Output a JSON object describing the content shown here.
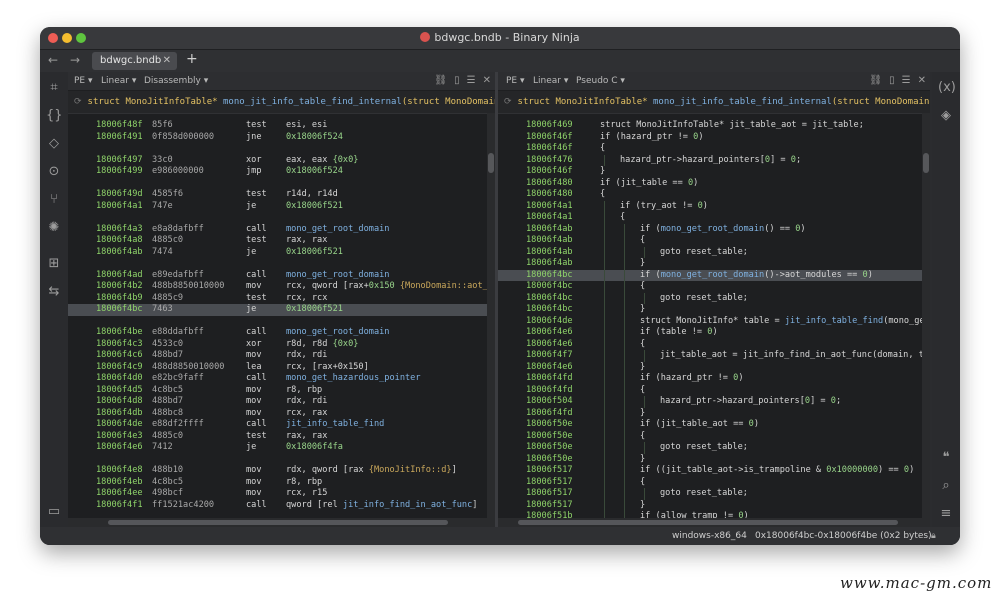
{
  "window": {
    "title": "bdwgc.bndb - Binary Ninja"
  },
  "tabs": [
    {
      "label": "bdwgc.bndb"
    }
  ],
  "left_pane": {
    "menu": [
      "PE ▾",
      "Linear ▾",
      "Disassembly ▾"
    ],
    "signature": {
      "ret_type": "struct MonoJitInfoTable*",
      "func": "mono_jit_info_table_find_internal",
      "params": "(struct MonoDomain*"
    },
    "rows": [
      {
        "addr": "18006f48f",
        "bytes": "85f6",
        "mn": "test",
        "ops": [
          {
            "t": "esi, esi"
          }
        ]
      },
      {
        "addr": "18006f491",
        "bytes": "0f858d000000",
        "mn": "jne",
        "ops": [
          {
            "t": "0x18006f524",
            "c": "num"
          }
        ]
      },
      {
        "blank": true
      },
      {
        "addr": "18006f497",
        "bytes": "33c0",
        "mn": "xor",
        "ops": [
          {
            "t": "eax, eax  "
          },
          {
            "t": "{0x0}",
            "c": "num"
          }
        ]
      },
      {
        "addr": "18006f499",
        "bytes": "e986000000",
        "mn": "jmp",
        "ops": [
          {
            "t": "0x18006f524",
            "c": "num"
          }
        ]
      },
      {
        "blank": true
      },
      {
        "addr": "18006f49d",
        "bytes": "4585f6",
        "mn": "test",
        "ops": [
          {
            "t": "r14d, r14d"
          }
        ]
      },
      {
        "addr": "18006f4a1",
        "bytes": "747e",
        "mn": "je",
        "ops": [
          {
            "t": "0x18006f521",
            "c": "num"
          }
        ]
      },
      {
        "blank": true
      },
      {
        "addr": "18006f4a3",
        "bytes": "e8a8dafbff",
        "mn": "call",
        "ops": [
          {
            "t": "mono_get_root_domain",
            "c": "fn"
          }
        ]
      },
      {
        "addr": "18006f4a8",
        "bytes": "4885c0",
        "mn": "test",
        "ops": [
          {
            "t": "rax, rax"
          }
        ]
      },
      {
        "addr": "18006f4ab",
        "bytes": "7474",
        "mn": "je",
        "ops": [
          {
            "t": "0x18006f521",
            "c": "num"
          }
        ]
      },
      {
        "blank": true
      },
      {
        "addr": "18006f4ad",
        "bytes": "e89edafbff",
        "mn": "call",
        "ops": [
          {
            "t": "mono_get_root_domain",
            "c": "fn"
          }
        ]
      },
      {
        "addr": "18006f4b2",
        "bytes": "488b8850010000",
        "mn": "mov",
        "ops": [
          {
            "t": "rcx, qword [rax+"
          },
          {
            "t": "0x150",
            "c": "num"
          },
          {
            "t": " "
          },
          {
            "t": "{MonoDomain::aot_m",
            "c": "type"
          }
        ]
      },
      {
        "addr": "18006f4b9",
        "bytes": "4885c9",
        "mn": "test",
        "ops": [
          {
            "t": "rcx, rcx"
          }
        ]
      },
      {
        "addr": "18006f4bc",
        "bytes": "7463",
        "mn": "je",
        "ops": [
          {
            "t": "0x18006f521",
            "c": "num"
          }
        ],
        "hl": true
      },
      {
        "blank": true
      },
      {
        "addr": "18006f4be",
        "bytes": "e88ddafbff",
        "mn": "call",
        "ops": [
          {
            "t": "mono_get_root_domain",
            "c": "fn"
          }
        ]
      },
      {
        "addr": "18006f4c3",
        "bytes": "4533c0",
        "mn": "xor",
        "ops": [
          {
            "t": "r8d, r8d  "
          },
          {
            "t": "{0x0}",
            "c": "num"
          }
        ]
      },
      {
        "addr": "18006f4c6",
        "bytes": "488bd7",
        "mn": "mov",
        "ops": [
          {
            "t": "rdx, rdi"
          }
        ]
      },
      {
        "addr": "18006f4c9",
        "bytes": "488d8850010000",
        "mn": "lea",
        "ops": [
          {
            "t": "rcx, [rax+0x150]"
          }
        ]
      },
      {
        "addr": "18006f4d0",
        "bytes": "e82bc9faff",
        "mn": "call",
        "ops": [
          {
            "t": "mono_get_hazardous_pointer",
            "c": "fn"
          }
        ]
      },
      {
        "addr": "18006f4d5",
        "bytes": "4c8bc5",
        "mn": "mov",
        "ops": [
          {
            "t": "r8, rbp"
          }
        ]
      },
      {
        "addr": "18006f4d8",
        "bytes": "488bd7",
        "mn": "mov",
        "ops": [
          {
            "t": "rdx, rdi"
          }
        ]
      },
      {
        "addr": "18006f4db",
        "bytes": "488bc8",
        "mn": "mov",
        "ops": [
          {
            "t": "rcx, rax"
          }
        ]
      },
      {
        "addr": "18006f4de",
        "bytes": "e88df2ffff",
        "mn": "call",
        "ops": [
          {
            "t": "jit_info_table_find",
            "c": "fn"
          }
        ]
      },
      {
        "addr": "18006f4e3",
        "bytes": "4885c0",
        "mn": "test",
        "ops": [
          {
            "t": "rax, rax"
          }
        ]
      },
      {
        "addr": "18006f4e6",
        "bytes": "7412",
        "mn": "je",
        "ops": [
          {
            "t": "0x18006f4fa",
            "c": "num"
          }
        ]
      },
      {
        "blank": true
      },
      {
        "addr": "18006f4e8",
        "bytes": "488b10",
        "mn": "mov",
        "ops": [
          {
            "t": "rdx, qword [rax "
          },
          {
            "t": "{MonoJitInfo::d}",
            "c": "type"
          },
          {
            "t": "]"
          }
        ]
      },
      {
        "addr": "18006f4eb",
        "bytes": "4c8bc5",
        "mn": "mov",
        "ops": [
          {
            "t": "r8, rbp"
          }
        ]
      },
      {
        "addr": "18006f4ee",
        "bytes": "498bcf",
        "mn": "mov",
        "ops": [
          {
            "t": "rcx, r15"
          }
        ]
      },
      {
        "addr": "18006f4f1",
        "bytes": "ff1521ac4200",
        "mn": "call",
        "ops": [
          {
            "t": "qword [rel "
          },
          {
            "t": "jit_info_find_in_aot_func",
            "c": "fn"
          },
          {
            "t": "]"
          }
        ]
      }
    ]
  },
  "right_pane": {
    "menu": [
      "PE ▾",
      "Linear ▾",
      "Pseudo C ▾"
    ],
    "signature": {
      "ret_type": "struct MonoJitInfoTable*",
      "func": "mono_jit_info_table_find_internal",
      "params": "(struct MonoDomain*"
    },
    "rows": [
      {
        "addr": "18006f469",
        "indent": 0,
        "code": [
          {
            "t": "struct MonoJitInfoTable* jit_table_aot = jit_table;"
          }
        ]
      },
      {
        "addr": "18006f46f",
        "indent": 0,
        "code": [
          {
            "t": "if (hazard_ptr != "
          },
          {
            "t": "0",
            "c": "num"
          },
          {
            "t": ")"
          }
        ]
      },
      {
        "addr": "18006f46f",
        "indent": 0,
        "code": [
          {
            "t": "{"
          }
        ]
      },
      {
        "addr": "18006f476",
        "indent": 1,
        "code": [
          {
            "t": "hazard_ptr->hazard_pointers["
          },
          {
            "t": "0",
            "c": "num"
          },
          {
            "t": "] = "
          },
          {
            "t": "0",
            "c": "num"
          },
          {
            "t": ";"
          }
        ]
      },
      {
        "addr": "18006f46f",
        "indent": 0,
        "code": [
          {
            "t": "}"
          }
        ]
      },
      {
        "addr": "18006f480",
        "indent": 0,
        "code": [
          {
            "t": "if (jit_table == "
          },
          {
            "t": "0",
            "c": "num"
          },
          {
            "t": ")"
          }
        ]
      },
      {
        "addr": "18006f480",
        "indent": 0,
        "code": [
          {
            "t": "{"
          }
        ]
      },
      {
        "addr": "18006f4a1",
        "indent": 1,
        "code": [
          {
            "t": "if (try_aot != "
          },
          {
            "t": "0",
            "c": "num"
          },
          {
            "t": ")"
          }
        ]
      },
      {
        "addr": "18006f4a1",
        "indent": 1,
        "code": [
          {
            "t": "{"
          }
        ]
      },
      {
        "addr": "18006f4ab",
        "indent": 2,
        "code": [
          {
            "t": "if ("
          },
          {
            "t": "mono_get_root_domain",
            "c": "fn"
          },
          {
            "t": "() == "
          },
          {
            "t": "0",
            "c": "num"
          },
          {
            "t": ")"
          }
        ]
      },
      {
        "addr": "18006f4ab",
        "indent": 2,
        "code": [
          {
            "t": "{"
          }
        ]
      },
      {
        "addr": "18006f4ab",
        "indent": 3,
        "code": [
          {
            "t": "goto reset_table;"
          }
        ]
      },
      {
        "addr": "18006f4ab",
        "indent": 2,
        "code": [
          {
            "t": "}"
          }
        ]
      },
      {
        "addr": "18006f4bc",
        "indent": 2,
        "hl": true,
        "code": [
          {
            "t": "if ("
          },
          {
            "t": "mono_get_root_domain",
            "c": "fn"
          },
          {
            "t": "()->aot_modules == "
          },
          {
            "t": "0",
            "c": "num"
          },
          {
            "t": ")"
          }
        ]
      },
      {
        "addr": "18006f4bc",
        "indent": 2,
        "code": [
          {
            "t": "{"
          }
        ]
      },
      {
        "addr": "18006f4bc",
        "indent": 3,
        "code": [
          {
            "t": "goto reset_table;"
          }
        ]
      },
      {
        "addr": "18006f4bc",
        "indent": 2,
        "code": [
          {
            "t": "}"
          }
        ]
      },
      {
        "addr": "18006f4de",
        "indent": 2,
        "code": [
          {
            "t": "struct MonoJitInfo* table = "
          },
          {
            "t": "jit_info_table_find",
            "c": "fn"
          },
          {
            "t": "(mono_ge"
          }
        ]
      },
      {
        "addr": "18006f4e6",
        "indent": 2,
        "code": [
          {
            "t": "if (table != "
          },
          {
            "t": "0",
            "c": "num"
          },
          {
            "t": ")"
          }
        ]
      },
      {
        "addr": "18006f4e6",
        "indent": 2,
        "code": [
          {
            "t": "{"
          }
        ]
      },
      {
        "addr": "18006f4f7",
        "indent": 3,
        "code": [
          {
            "t": "jit_table_aot = jit_info_find_in_aot_func(domain, t"
          }
        ]
      },
      {
        "addr": "18006f4e6",
        "indent": 2,
        "code": [
          {
            "t": "}"
          }
        ]
      },
      {
        "addr": "18006f4fd",
        "indent": 2,
        "code": [
          {
            "t": "if (hazard_ptr != "
          },
          {
            "t": "0",
            "c": "num"
          },
          {
            "t": ")"
          }
        ]
      },
      {
        "addr": "18006f4fd",
        "indent": 2,
        "code": [
          {
            "t": "{"
          }
        ]
      },
      {
        "addr": "18006f504",
        "indent": 3,
        "code": [
          {
            "t": "hazard_ptr->hazard_pointers["
          },
          {
            "t": "0",
            "c": "num"
          },
          {
            "t": "] = "
          },
          {
            "t": "0",
            "c": "num"
          },
          {
            "t": ";"
          }
        ]
      },
      {
        "addr": "18006f4fd",
        "indent": 2,
        "code": [
          {
            "t": "}"
          }
        ]
      },
      {
        "addr": "18006f50e",
        "indent": 2,
        "code": [
          {
            "t": "if (jit_table_aot == "
          },
          {
            "t": "0",
            "c": "num"
          },
          {
            "t": ")"
          }
        ]
      },
      {
        "addr": "18006f50e",
        "indent": 2,
        "code": [
          {
            "t": "{"
          }
        ]
      },
      {
        "addr": "18006f50e",
        "indent": 3,
        "code": [
          {
            "t": "goto reset_table;"
          }
        ]
      },
      {
        "addr": "18006f50e",
        "indent": 2,
        "code": [
          {
            "t": "}"
          }
        ]
      },
      {
        "addr": "18006f517",
        "indent": 2,
        "code": [
          {
            "t": "if ((jit_table_aot->is_trampoline & "
          },
          {
            "t": "0x10000000",
            "c": "num"
          },
          {
            "t": ") == "
          },
          {
            "t": "0",
            "c": "num"
          },
          {
            "t": ")"
          }
        ]
      },
      {
        "addr": "18006f517",
        "indent": 2,
        "code": [
          {
            "t": "{"
          }
        ]
      },
      {
        "addr": "18006f517",
        "indent": 3,
        "code": [
          {
            "t": "goto reset_table;"
          }
        ]
      },
      {
        "addr": "18006f517",
        "indent": 2,
        "code": [
          {
            "t": "}"
          }
        ]
      },
      {
        "addr": "18006f51b",
        "indent": 2,
        "code": [
          {
            "t": "if (allow_tramp != "
          },
          {
            "t": "0",
            "c": "num"
          },
          {
            "t": ")"
          }
        ]
      }
    ]
  },
  "status": {
    "arch": "windows-x86_64",
    "range": "0x18006f4bc-0x18006f4be (0x2 bytes)"
  },
  "watermark": "www.mac-gm.com"
}
